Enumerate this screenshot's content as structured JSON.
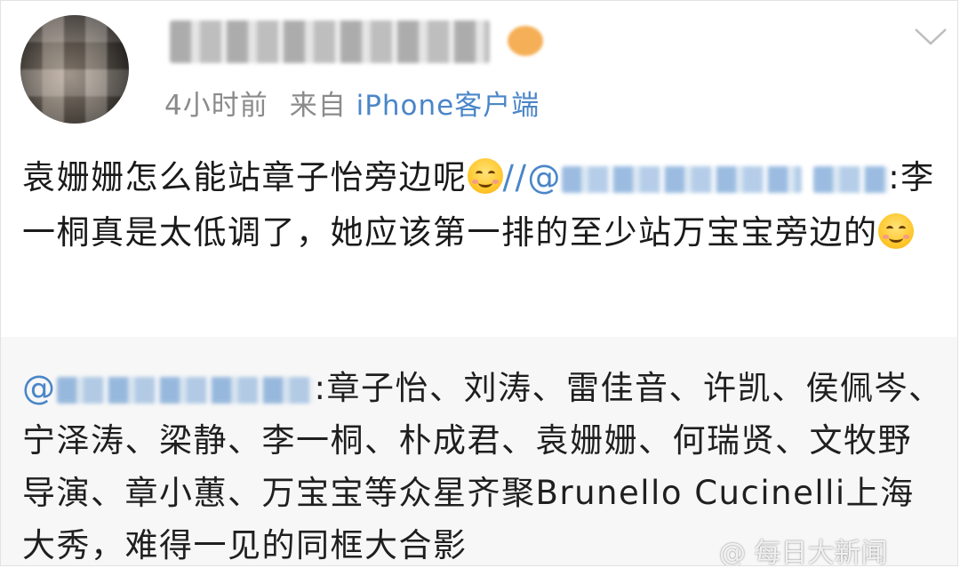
{
  "post": {
    "time": "4小时前",
    "source_prefix": "来自",
    "source_client": "iPhone客户端",
    "text_1": "袁姗姗怎么能站章子怡旁边呢",
    "repost_sep": "//@",
    "text_2": ":李一桐真是太低调了，她应该第一排的至少站万宝宝旁边的"
  },
  "repost": {
    "at": "@",
    "text": ":章子怡、刘涛、雷佳音、许凯、侯佩岑、宁泽涛、梁静、李一桐、朴成君、袁姗姗、何瑞贤、文牧野导演、章小蕙、万宝宝等众星齐聚Brunello Cucinelli上海大秀，难得一见的同框大合影"
  },
  "watermark": {
    "text": "@ 每日大新闻"
  },
  "icons": {
    "menu": "chevron-down-icon",
    "emoji": "smile-emoji-icon"
  }
}
